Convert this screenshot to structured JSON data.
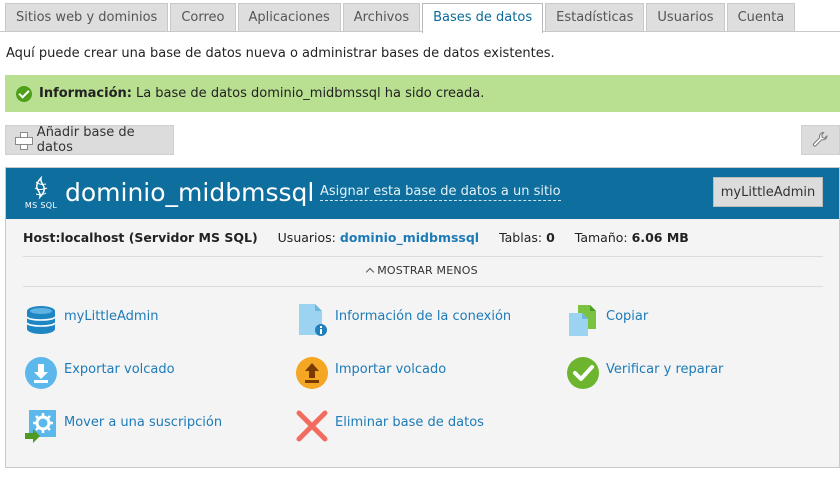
{
  "tabs": [
    {
      "label": "Sitios web y dominios",
      "active": false
    },
    {
      "label": "Correo",
      "active": false
    },
    {
      "label": "Aplicaciones",
      "active": false
    },
    {
      "label": "Archivos",
      "active": false
    },
    {
      "label": "Bases de datos",
      "active": true
    },
    {
      "label": "Estadísticas",
      "active": false
    },
    {
      "label": "Usuarios",
      "active": false
    },
    {
      "label": "Cuenta",
      "active": false
    }
  ],
  "intro": "Aquí puede crear una base de datos nueva o administrar bases de datos existentes.",
  "message": {
    "label": "Información:",
    "text": "La base de datos dominio_midbmssql ha sido creada."
  },
  "toolbar": {
    "add_label": "Añadir base de datos"
  },
  "database": {
    "type_label": "MS SQL",
    "name": "dominio_midbmssql",
    "assign_link": "Asignar esta base de datos a un sitio",
    "admin_button": "myLittleAdmin",
    "host": "Host:localhost (Servidor MS SQL)",
    "users_label": "Usuarios:",
    "users_value": "dominio_midbmssql",
    "tables_label": "Tablas:",
    "tables_value": "0",
    "size_label": "Tamaño:",
    "size_value": "6.06 MB",
    "toggle_label": "MOSTRAR MENOS"
  },
  "actions": [
    {
      "label": "myLittleAdmin",
      "icon": "database-icon"
    },
    {
      "label": "Información de la conexión",
      "icon": "connection-info-icon"
    },
    {
      "label": "Copiar",
      "icon": "copy-icon"
    },
    {
      "label": "Exportar volcado",
      "icon": "export-dump-icon"
    },
    {
      "label": "Importar volcado",
      "icon": "import-dump-icon"
    },
    {
      "label": "Verificar y reparar",
      "icon": "check-repair-icon"
    },
    {
      "label": "Mover a una suscripción",
      "icon": "move-subscription-icon"
    },
    {
      "label": "Eliminar base de datos",
      "icon": "delete-icon"
    }
  ],
  "colors": {
    "header_blue": "#0e6e9e",
    "link_blue": "#1d7bb8",
    "success_bg": "#b9df91"
  }
}
